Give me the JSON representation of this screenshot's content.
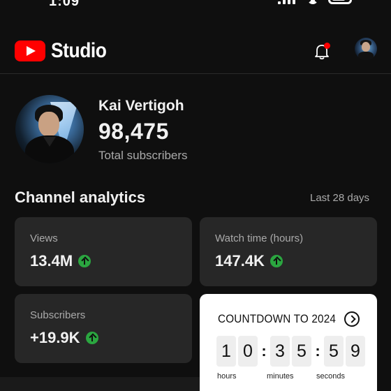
{
  "status_bar": {
    "time": "1:09"
  },
  "header": {
    "logo_icon": "youtube-play-icon",
    "logo_text": "Studio",
    "notification_icon": "bell-icon",
    "notification_badge_color": "#ff0000"
  },
  "channel": {
    "name": "Kai Vertigoh",
    "subscriber_count": "98,475",
    "subscriber_label": "Total subscribers"
  },
  "analytics": {
    "title": "Channel analytics",
    "range": "Last 28 days",
    "cards": [
      {
        "label": "Views",
        "value": "13.4M",
        "trend": "up"
      },
      {
        "label": "Watch time (hours)",
        "value": "147.4K",
        "trend": "up"
      },
      {
        "label": "Subscribers",
        "value": "+19.9K",
        "trend": "up"
      }
    ],
    "trend_color": "#2ba640"
  },
  "countdown": {
    "title": "COUNTDOWN TO 2024",
    "digits": {
      "h1": "1",
      "h2": "0",
      "m1": "3",
      "m2": "5",
      "s1": "5",
      "s2": "9"
    },
    "units": {
      "hours": "hours",
      "minutes": "minutes",
      "seconds": "seconds"
    }
  },
  "colors": {
    "background": "#0f0f0f",
    "card": "#272727",
    "brand_red": "#ff0000"
  }
}
